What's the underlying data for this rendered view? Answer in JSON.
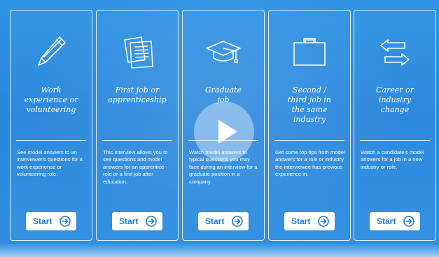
{
  "cards": [
    {
      "icon": "pencil-icon",
      "title_lines": [
        "Work",
        "experience or",
        "volunteering"
      ],
      "description": "See model answers to an interviewer's questions for a work experience or volunteering role.",
      "button_label": "Start",
      "button_icon": "arrow-right-circle-icon"
    },
    {
      "icon": "documents-icon",
      "title_lines": [
        "First job or",
        "apprenticeship"
      ],
      "description": "This interview allows you to see questions and model answers for an apprentice role or a first job after education.",
      "button_label": "Start",
      "button_icon": "arrow-right-circle-icon"
    },
    {
      "icon": "graduation-cap-icon",
      "title_lines": [
        "Graduate",
        "job"
      ],
      "description": "Watch model answers to typical questions you may face during an interview for a graduate position in a company.",
      "button_label": "Start",
      "button_icon": "arrow-right-circle-icon"
    },
    {
      "icon": "briefcase-icon",
      "title_lines": [
        "Second /",
        "third job in",
        "the same",
        "industry"
      ],
      "description": "Get some top tips from model answers for a role or industry the interviewee has previous experience in.",
      "button_label": "Start",
      "button_icon": "arrow-right-circle-icon"
    },
    {
      "icon": "swap-arrows-icon",
      "title_lines": [
        "Career or",
        "industry",
        "change"
      ],
      "description": "Watch a candidate's model answers for a job in a new industry or role.",
      "button_label": "Start",
      "button_icon": "arrow-right-circle-icon"
    }
  ],
  "video": {
    "play_icon": "play-icon"
  },
  "colors": {
    "background": "#2786dc",
    "card_border": "#ffffff",
    "button_bg": "#ffffff",
    "button_text": "#1f7bd3"
  }
}
